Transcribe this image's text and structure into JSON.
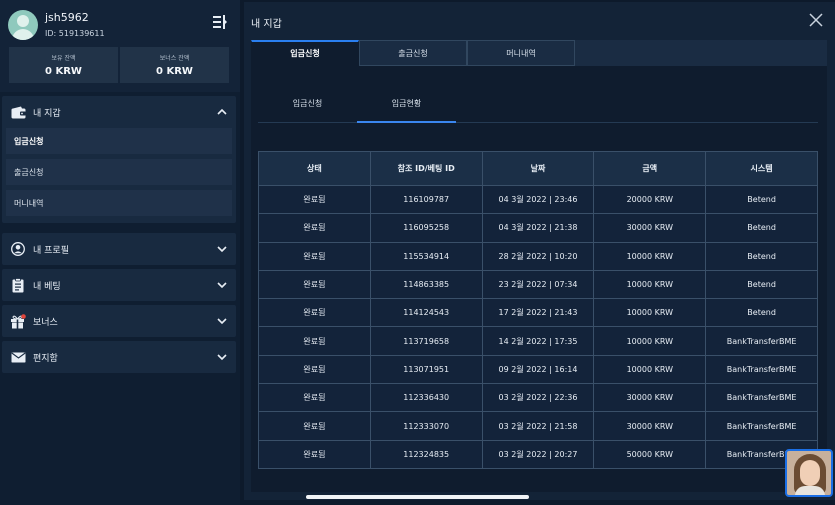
{
  "profile": {
    "username": "jsh5962",
    "user_id": "ID: 519139611",
    "balances": [
      {
        "label": "보유 잔액",
        "value": "0 KRW"
      },
      {
        "label": "보너스 잔액",
        "value": "0 KRW"
      }
    ]
  },
  "sidebar": {
    "wallet": {
      "label": "내 지갑",
      "icon": "wallet-icon",
      "items": [
        "입금신청",
        "출금신청",
        "머니내역"
      ]
    },
    "profile": {
      "label": "내 프로필",
      "icon": "user-icon"
    },
    "betting": {
      "label": "내 베팅",
      "icon": "clipboard-icon"
    },
    "bonus": {
      "label": "보너스",
      "icon": "gift-icon"
    },
    "mailbox": {
      "label": "편지함",
      "icon": "envelope-icon"
    }
  },
  "panel": {
    "title": "내 지갑",
    "tabs": [
      "입금신청",
      "출금신청",
      "머니내역"
    ],
    "subtabs": [
      "입금신청",
      "입금현황"
    ]
  },
  "table": {
    "headers": [
      "상태",
      "참조 ID/베팅 ID",
      "날짜",
      "금액",
      "시스템"
    ],
    "rows": [
      [
        "완료됨",
        "116109787",
        "04 3월 2022 | 23:46",
        "20000 KRW",
        "Betend"
      ],
      [
        "완료됨",
        "116095258",
        "04 3월 2022 | 21:38",
        "30000 KRW",
        "Betend"
      ],
      [
        "완료됨",
        "115534914",
        "28 2월 2022 | 10:20",
        "10000 KRW",
        "Betend"
      ],
      [
        "완료됨",
        "114863385",
        "23 2월 2022 | 07:34",
        "10000 KRW",
        "Betend"
      ],
      [
        "완료됨",
        "114124543",
        "17 2월 2022 | 21:43",
        "10000 KRW",
        "Betend"
      ],
      [
        "완료됨",
        "113719658",
        "14 2월 2022 | 17:35",
        "10000 KRW",
        "BankTransferBME"
      ],
      [
        "완료됨",
        "113071951",
        "09 2월 2022 | 16:14",
        "10000 KRW",
        "BankTransferBME"
      ],
      [
        "완료됨",
        "112336430",
        "03 2월 2022 | 22:36",
        "30000 KRW",
        "BankTransferBME"
      ],
      [
        "완료됨",
        "112333070",
        "03 2월 2022 | 21:58",
        "30000 KRW",
        "BankTransferBME"
      ],
      [
        "완료됨",
        "112324835",
        "03 2월 2022 | 20:27",
        "50000 KRW",
        "BankTransferBME"
      ]
    ]
  },
  "colors": {
    "accent": "#2a7ff0",
    "background": "#0d1a2b"
  }
}
